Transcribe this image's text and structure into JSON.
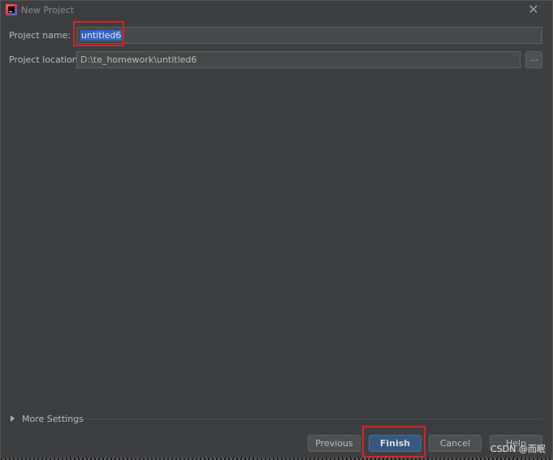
{
  "window": {
    "title": "New Project",
    "close_icon": "close-icon"
  },
  "form": {
    "project_name_label": "Project name:",
    "project_name_value": "untitled6",
    "project_location_label": "Project location:",
    "project_location_value": "D:\\te_homework\\untitled6",
    "browse_label": "..."
  },
  "more_settings": {
    "label": "More Settings",
    "expanded": false
  },
  "buttons": {
    "previous": "Previous",
    "finish": "Finish",
    "cancel": "Cancel",
    "help": "Help"
  },
  "watermark": "CSDN @而眠",
  "colors": {
    "background": "#3c3f41",
    "field_bg": "#45494a",
    "selection": "#2f65ca",
    "primary_button": "#365880",
    "highlight_box": "#e02020"
  }
}
